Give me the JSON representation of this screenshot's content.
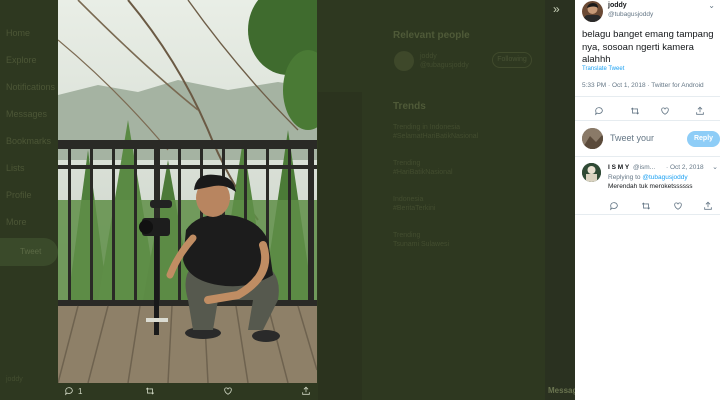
{
  "background": {
    "nav_items": [
      "Home",
      "Explore",
      "Notifications",
      "Messages",
      "Bookmarks",
      "Lists",
      "Profile",
      "More"
    ],
    "tweet_button": "Tweet",
    "footer": "joddy",
    "relevant_title": "Relevant people",
    "relevant_name": "joddy",
    "relevant_handle": "@tubagusjoddy",
    "follow_label": "Following",
    "trends_title": "Trends",
    "trends": [
      "Trending in Indonesia",
      "#SelamatHariBatikNasional",
      "Trending",
      "#HariBatikNasional",
      "Indonesia",
      "#BeritaTerkini",
      "Trending",
      "Tsunami Sulawesi"
    ],
    "messages_label": "Messages"
  },
  "photo": {
    "alt": "Young man crouching on a wooden deck holding a camera gimbal"
  },
  "action_bar": {
    "reply_count": "1",
    "retweet_count": "",
    "like_count": ""
  },
  "tweet": {
    "name": "joddy",
    "handle": "@tubagusjoddy",
    "text": "belagu banget emang tampang nya, sosoan ngerti kamera alahhh",
    "translate": "Translate Tweet",
    "meta": "5:33 PM · Oct 1, 2018 · Twitter for Android"
  },
  "compose": {
    "placeholder": "Tweet your",
    "reply_button": "Reply"
  },
  "reply": {
    "name": "I S M Y",
    "handle": "@ism...",
    "date": "· Oct 2, 2018",
    "replying_prefix": "Replying to",
    "replying_handle": "@tubagusjoddy",
    "text": "Merendah tuk meroketssssss"
  },
  "colors": {
    "accent": "#1da1f2",
    "reply_button": "#8ecdf7",
    "overlay": "#2e3820"
  }
}
